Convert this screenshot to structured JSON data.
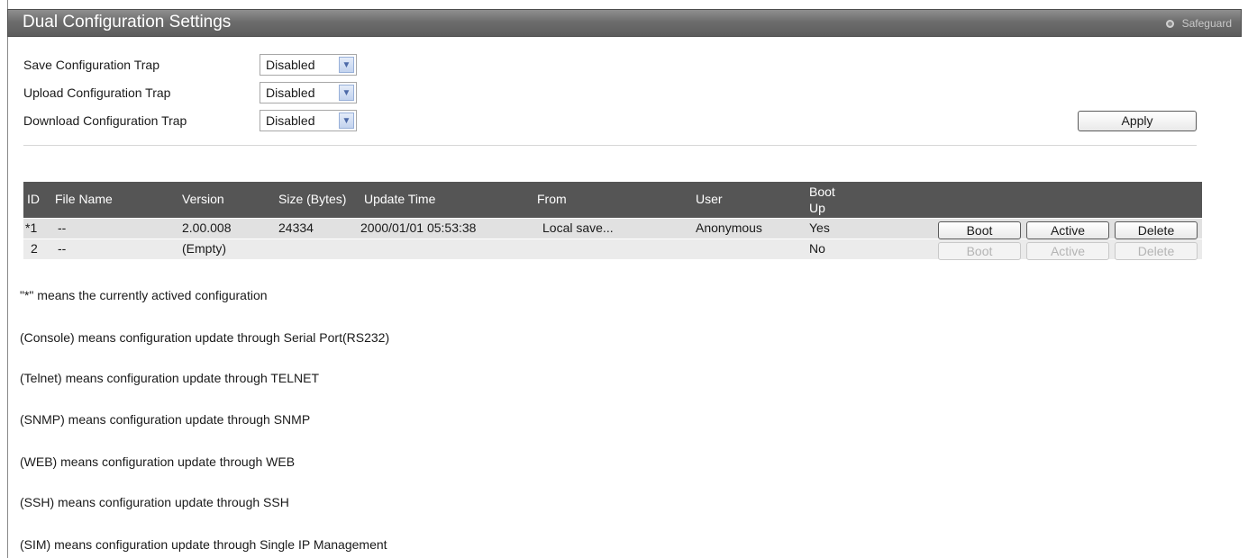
{
  "header": {
    "title": "Dual Configuration Settings",
    "safeguard": "Safeguard"
  },
  "settings": [
    {
      "label": "Save Configuration Trap",
      "value": "Disabled"
    },
    {
      "label": "Upload Configuration Trap",
      "value": "Disabled"
    },
    {
      "label": "Download Configuration Trap",
      "value": "Disabled"
    }
  ],
  "apply_label": "Apply",
  "table": {
    "columns": [
      "ID",
      "File Name",
      "Version",
      "Size (Bytes)",
      "Update Time",
      "From",
      "User",
      "Boot",
      "Up"
    ],
    "rows": [
      {
        "id": "*1",
        "file_name": "--",
        "version": "2.00.008",
        "size": "24334",
        "update_time": "2000/01/01 05:53:38",
        "from": "Local save...",
        "user": "Anonymous",
        "boot_up": "Yes",
        "actions": [
          "Boot",
          "Active",
          "Delete"
        ]
      },
      {
        "id": "2",
        "file_name": "--",
        "version": "(Empty)",
        "size": "",
        "update_time": "",
        "from": "",
        "user": "",
        "boot_up": "No",
        "actions": [
          "Boot",
          "Active",
          "Delete"
        ]
      }
    ]
  },
  "notes": [
    "\"*\" means the currently actived configuration",
    "(Console) means configuration update through Serial Port(RS232)",
    "(Telnet) means configuration update through TELNET",
    "(SNMP) means configuration update through SNMP",
    "(WEB) means configuration update through WEB",
    "(SSH) means configuration update through SSH",
    "(SIM) means configuration update through Single IP Management"
  ]
}
